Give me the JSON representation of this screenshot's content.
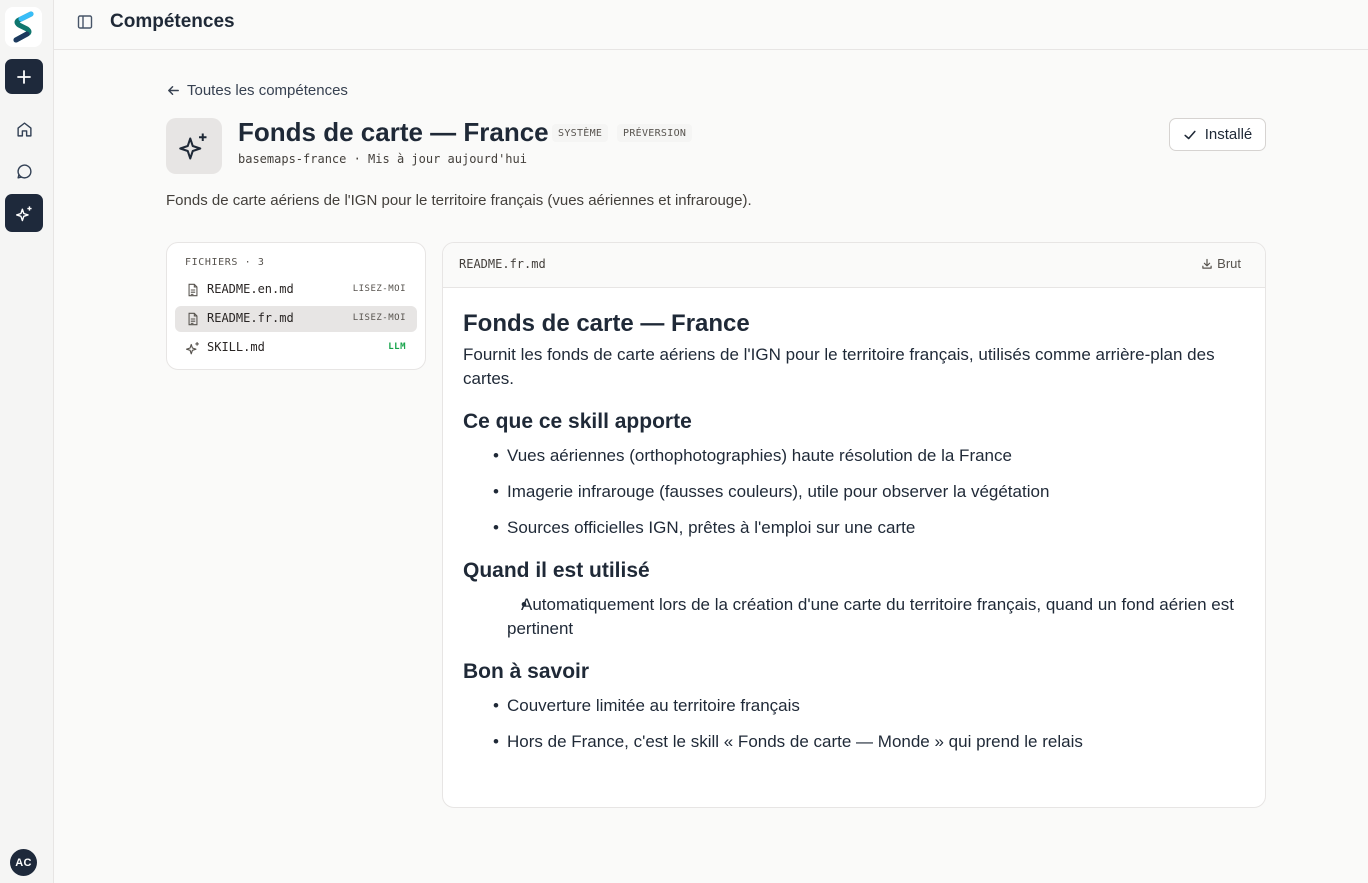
{
  "app": {
    "page_title": "Compétences",
    "user_initials": "AC",
    "brand_color": "#1e293b",
    "accent_green": "#16a34a"
  },
  "rail": {
    "items": [
      {
        "name": "new",
        "icon": "plus-icon"
      },
      {
        "name": "home",
        "icon": "home-icon"
      },
      {
        "name": "chat",
        "icon": "chat-bubble-icon"
      },
      {
        "name": "skills",
        "icon": "sparkles-icon",
        "active": true
      }
    ]
  },
  "skill": {
    "back_label": "Toutes les compétences",
    "title": "Fonds de carte — France",
    "badges": [
      "SYSTÈME",
      "PRÉVERSION"
    ],
    "meta": "basemaps-france · Mis à jour aujourd'hui",
    "installed_label": "Installé",
    "description": "Fonds de carte aériens de l'IGN pour le territoire français (vues aériennes et infrarouge)."
  },
  "files": {
    "header": "FICHIERS · 3",
    "items": [
      {
        "name": "README.en.md",
        "tag": "LISEZ-MOI",
        "icon": "document-icon",
        "active": false
      },
      {
        "name": "README.fr.md",
        "tag": "LISEZ-MOI",
        "icon": "document-icon",
        "active": true
      },
      {
        "name": "SKILL.md",
        "tag": "LLM",
        "icon": "sparkles-icon",
        "active": false
      }
    ]
  },
  "viewer": {
    "file_name": "README.fr.md",
    "raw_label": "Brut",
    "doc": {
      "h1": "Fonds de carte — France",
      "intro": "Fournit les fonds de carte aériens de l'IGN pour le territoire français, utilisés comme arrière-plan des cartes.",
      "sections": [
        {
          "heading": "Ce que ce skill apporte",
          "items": [
            "Vues aériennes (orthophotographies) haute résolution de la France",
            "Imagerie infrarouge (fausses couleurs), utile pour observer la végétation",
            "Sources officielles IGN, prêtes à l'emploi sur une carte"
          ]
        },
        {
          "heading": "Quand il est utilisé",
          "items": [
            "Automatiquement lors de la création d'une carte du territoire français, quand un fond aérien est pertinent"
          ]
        },
        {
          "heading": "Bon à savoir",
          "items": [
            "Couverture limitée au territoire français",
            "Hors de France, c'est le skill « Fonds de carte — Monde » qui prend le relais"
          ]
        }
      ]
    }
  }
}
